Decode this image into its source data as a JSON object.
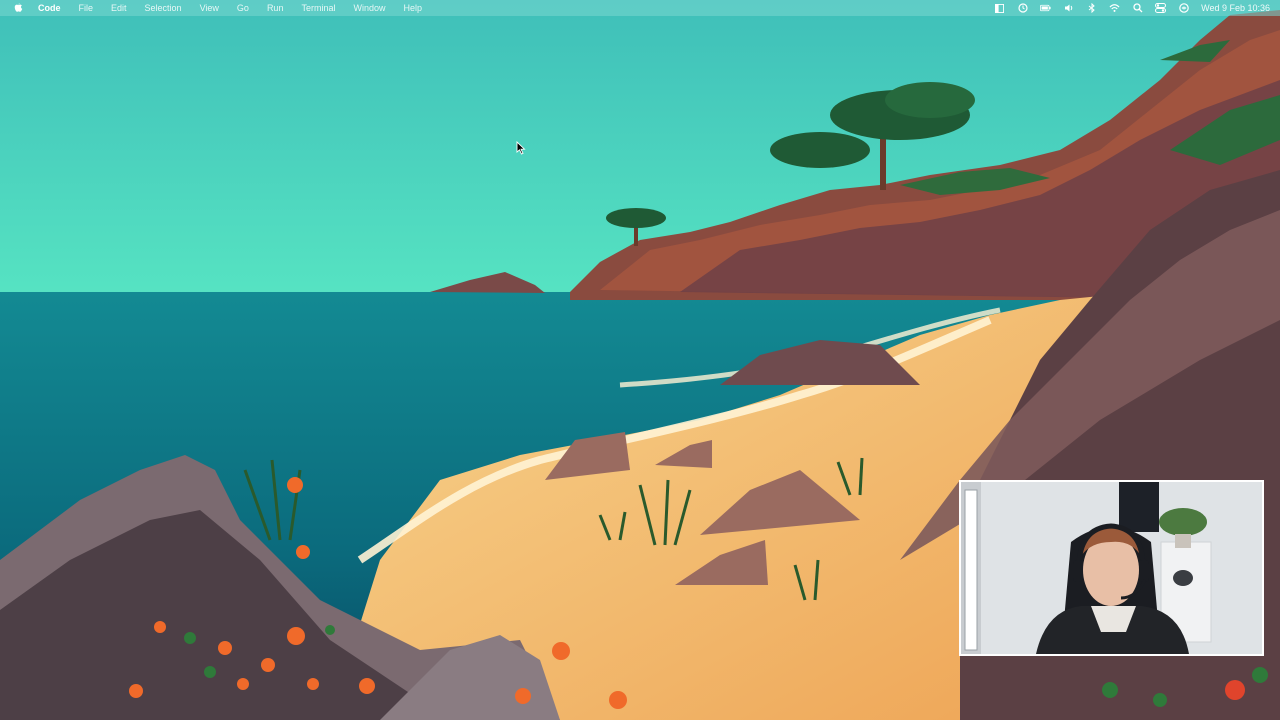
{
  "menubar": {
    "app_name": "Code",
    "menus": [
      "File",
      "Edit",
      "Selection",
      "View",
      "Go",
      "Run",
      "Terminal",
      "Window",
      "Help"
    ],
    "status_icons": [
      "sidebar-icon",
      "focus-icon",
      "battery-icon",
      "volume-icon",
      "bluetooth-icon",
      "wifi-icon",
      "search-icon",
      "control-center-icon",
      "siri-icon"
    ],
    "clock": "Wed 9 Feb  10:36"
  },
  "colors": {
    "sky": "#46cdb9",
    "sea": "#0d6d7e",
    "sand": "#f0b463",
    "rock": "#6f4b4e",
    "menubar_text": "#ffffff"
  }
}
